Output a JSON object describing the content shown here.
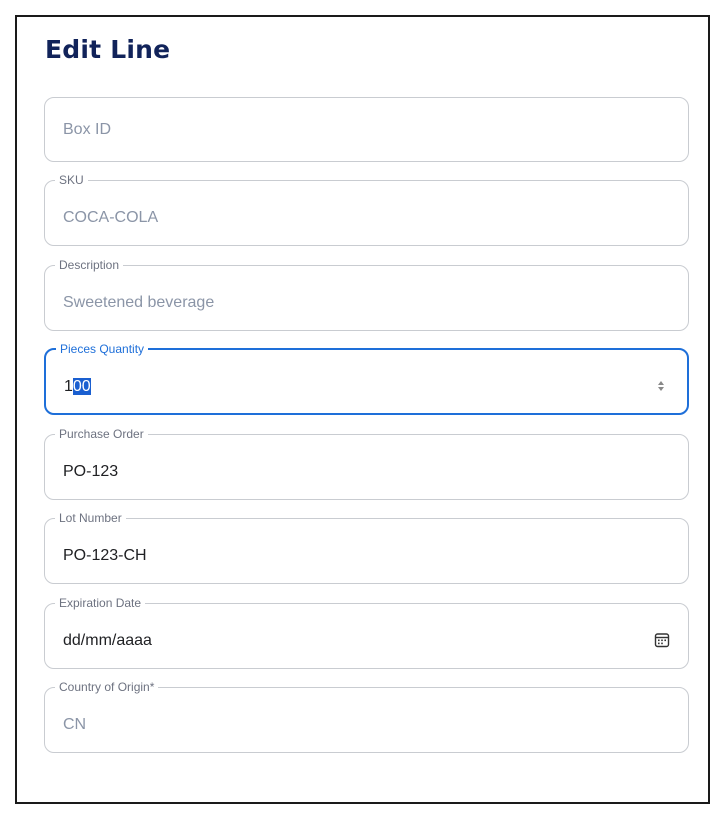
{
  "dialog": {
    "title": "Edit Line"
  },
  "fields": {
    "box_id": {
      "placeholder": "Box ID"
    },
    "sku": {
      "label": "SKU",
      "value": "COCA-COLA"
    },
    "description": {
      "label": "Description",
      "value": "Sweetened beverage"
    },
    "pieces_quantity": {
      "label": "Pieces Quantity",
      "value_prefix": "1",
      "value_selected": "00"
    },
    "purchase_order": {
      "label": "Purchase Order",
      "value": "PO-123"
    },
    "lot_number": {
      "label": "Lot Number",
      "value": "PO-123-CH"
    },
    "expiration_date": {
      "label": "Expiration Date",
      "value": "dd/mm/aaaa",
      "icon": "calendar-icon"
    },
    "country_of_origin": {
      "label": "Country of Origin*",
      "value": "CN"
    }
  },
  "colors": {
    "title": "#11235a",
    "focus": "#1e6fd9",
    "selection": "#1a5fd0",
    "disabled_text": "#8b95a7"
  }
}
